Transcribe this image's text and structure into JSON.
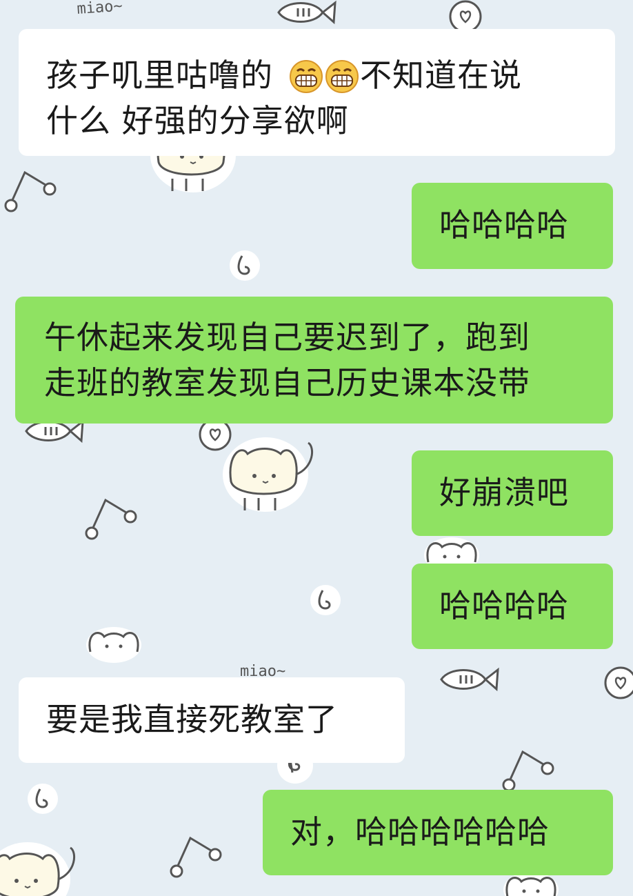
{
  "chat": {
    "messages": [
      {
        "id": "m1",
        "side": "left",
        "text_a": "孩子叽里咕噜的",
        "emoji": "grinning-face-emoji",
        "text_b": "不知道在说",
        "text_c": "什么 好强的分享欲啊"
      },
      {
        "id": "m2",
        "side": "right",
        "text": "哈哈哈哈"
      },
      {
        "id": "m3",
        "side": "right",
        "line1": "午休起来发现自己要迟到了，跑到",
        "line2": "走班的教室发现自己历史课本没带"
      },
      {
        "id": "m4",
        "side": "right",
        "text": "好崩溃吧"
      },
      {
        "id": "m5",
        "side": "right",
        "text": "哈哈哈哈"
      },
      {
        "id": "m6",
        "side": "left",
        "text": "要是我直接死教室了"
      },
      {
        "id": "m7",
        "side": "right",
        "text": "对，哈哈哈哈哈哈"
      }
    ]
  },
  "wallpaper": {
    "label": "miao~",
    "colors": {
      "background": "#e6eef4",
      "outgoing_bubble": "#8fe262",
      "incoming_bubble": "#ffffff"
    },
    "icons": [
      "cat-sticker-icon",
      "fish-icon",
      "swirl-icon",
      "heart-bubble-icon",
      "music-note-icon",
      "cat-face-icon"
    ]
  }
}
